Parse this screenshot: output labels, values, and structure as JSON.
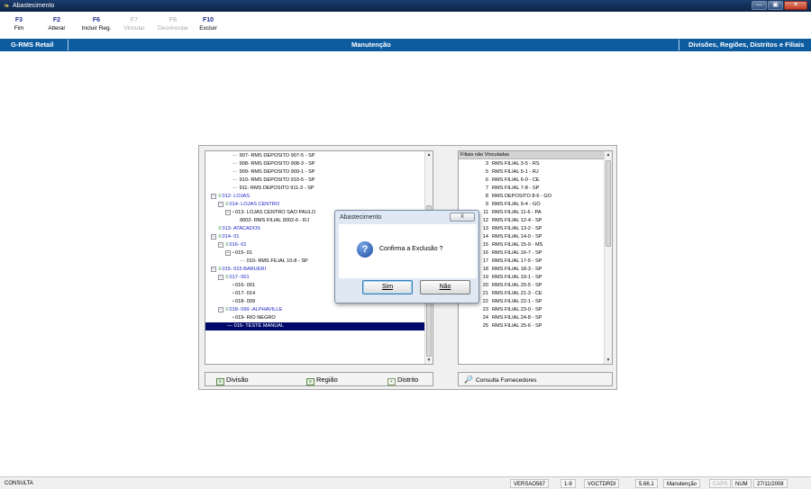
{
  "window": {
    "title": "Abastecimento",
    "controls": [
      "—",
      "▣",
      "✕"
    ]
  },
  "fkeys": [
    {
      "key": "F3",
      "label": "Fim",
      "enabled": true
    },
    {
      "key": "F2",
      "label": "Alterar",
      "enabled": true
    },
    {
      "key": "F6",
      "label": "Incluir Reg.",
      "enabled": true
    },
    {
      "key": "F7",
      "label": "Vincular",
      "enabled": false
    },
    {
      "key": "F8",
      "label": "Desvincular",
      "enabled": false
    },
    {
      "key": "F10",
      "label": "Excluir",
      "enabled": true
    }
  ],
  "band": {
    "left": "G-RMS Retail",
    "center": "Manutenção",
    "right": "Divisões, Regiões, Distritos e Filiais"
  },
  "tree": {
    "rows": [
      {
        "text": "907- RMS DEPOSITO 907-5 - SP"
      },
      {
        "text": "908- RMS DEPOSITO 908-3 - SP"
      },
      {
        "text": "909- RMS DEPOSITO 909-1 - SP"
      },
      {
        "text": "910- RMS DEPOSITO 910-5 - SP"
      },
      {
        "text": "911- RMS DEPOSITO 911-3 - SP"
      },
      {
        "text": "012- LOJAS"
      },
      {
        "text": "014- LOJAS CENTRO"
      },
      {
        "text": "013- LOJAS CENTRO SAO PAULO"
      },
      {
        "text": "9002- RMS FILIAL 9002-6 - RJ"
      },
      {
        "text": "013- ATACADOS"
      },
      {
        "text": "014- 01"
      },
      {
        "text": "016- 01"
      },
      {
        "text": "015- 01"
      },
      {
        "text": "010- RMS FILIAL 10-8 - SP"
      },
      {
        "text": "015- 015 BARUERI"
      },
      {
        "text": "017- 001"
      },
      {
        "text": "016- 001"
      },
      {
        "text": "017- 014"
      },
      {
        "text": "018- 009"
      },
      {
        "text": "018- 099 -ALPHAVILLE"
      },
      {
        "text": "019- RIO NEGRO"
      },
      {
        "text": "016- TESTE MANUAL"
      }
    ],
    "buttons": {
      "division": "Divisão",
      "region": "Região",
      "district": "Distrito"
    }
  },
  "list": {
    "header": "Filiais não Vinculadas",
    "rows": [
      {
        "n": "3",
        "t": "RMS FILIAL 3-5 - RS"
      },
      {
        "n": "5",
        "t": "RMS FILIAL 5-1 - RJ"
      },
      {
        "n": "6",
        "t": "RMS FILIAL 6-0 - CE"
      },
      {
        "n": "7",
        "t": "RMS FILIAL 7-8 - SP"
      },
      {
        "n": "8",
        "t": "RMS DEPOSITO 8-6 - GO"
      },
      {
        "n": "9",
        "t": "RMS FILIAL 9-4 - GO"
      },
      {
        "n": "11",
        "t": "RMS FILIAL 11-6 - PA"
      },
      {
        "n": "12",
        "t": "RMS FILIAL 12-4 - SP"
      },
      {
        "n": "13",
        "t": "RMS FILIAL 13-2 - SP"
      },
      {
        "n": "14",
        "t": "RMS FILIAL 14-0 - SP"
      },
      {
        "n": "15",
        "t": "RMS FILIAL 15-9 - MS"
      },
      {
        "n": "16",
        "t": "RMS FILIAL 16-7 - SP"
      },
      {
        "n": "17",
        "t": "RMS FILIAL 17-5 - SP"
      },
      {
        "n": "18",
        "t": "RMS FILIAL 18-3 - SP"
      },
      {
        "n": "19",
        "t": "RMS FILIAL 19-1 - SP"
      },
      {
        "n": "20",
        "t": "RMS FILIAL 20-5 - SP"
      },
      {
        "n": "21",
        "t": "RMS FILIAL 21-3 - CE"
      },
      {
        "n": "22",
        "t": "RMS FILIAL 22-1 - SP"
      },
      {
        "n": "23",
        "t": "RMS FILIAL 23-0 - SP"
      },
      {
        "n": "24",
        "t": "RMS FILIAL 24-8 - SP"
      },
      {
        "n": "25",
        "t": "RMS FILIAL 25-6 - SP"
      }
    ],
    "button": "Consulta Fornecedores"
  },
  "dialog": {
    "title": "Abastecimento",
    "close": "X",
    "message": "Confirma a Exclusão ?",
    "yes": "Sim",
    "no": "Não"
  },
  "status": {
    "mode": "CONSULTA",
    "version": "VERSAO567",
    "pages": "1-9",
    "program": "VGCTDRDI",
    "build": "5.66.1",
    "screen": "Manutenção",
    "caps": "CAPS",
    "num": "NUM",
    "date": "27/11/2008"
  }
}
